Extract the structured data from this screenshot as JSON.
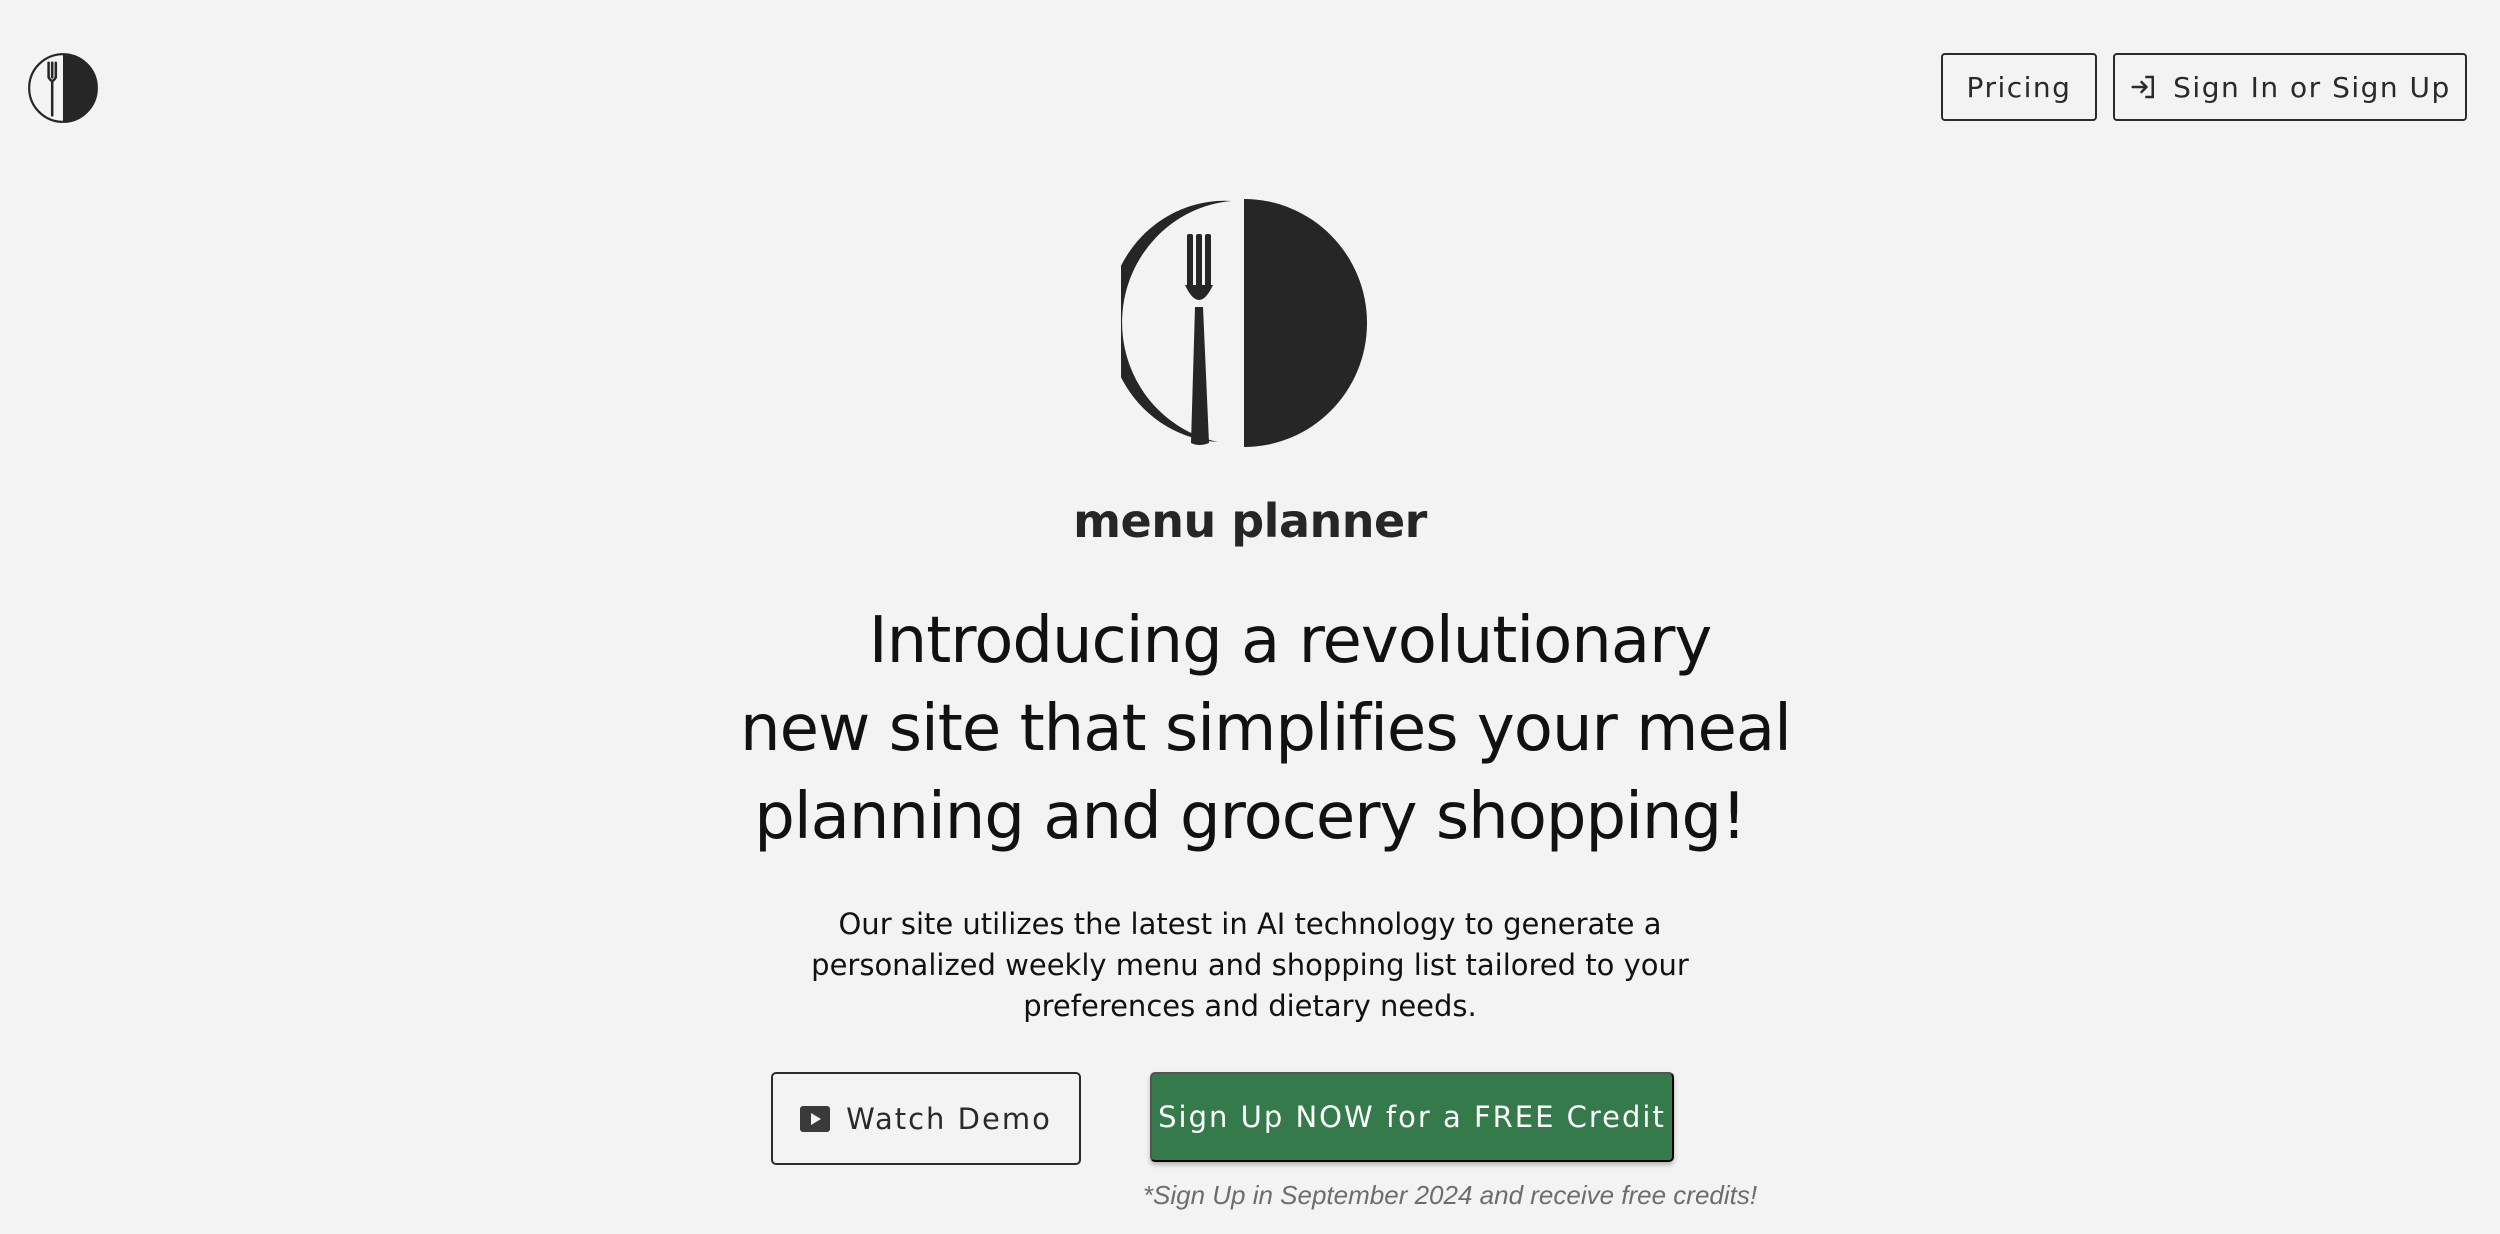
{
  "brand": {
    "name": "menu planner",
    "logo_icon": "fork-plate-logo-icon"
  },
  "nav": {
    "pricing_label": "Pricing",
    "signin_label": "Sign In or Sign Up",
    "signin_icon": "login-arrow-icon"
  },
  "hero": {
    "headline_lines": [
      "Introducing a revolutionary",
      "new site that simplifies your meal",
      "planning and grocery shopping!"
    ],
    "description": "Our site utilizes the latest in AI technology to generate a personalized weekly menu and shopping list tailored to your preferences and dietary needs.",
    "demo_button_label": "Watch Demo",
    "demo_icon": "play-video-icon",
    "signup_button_label": "Sign Up NOW for a FREE Credit",
    "promo_note": "*Sign Up in September 2024 and receive free credits!"
  },
  "colors": {
    "background": "#f3f3f3",
    "accent_green": "#357a4b",
    "logo_dark": "#262626",
    "border": "#2b2b2b",
    "note_gray": "#6d6d6d"
  }
}
